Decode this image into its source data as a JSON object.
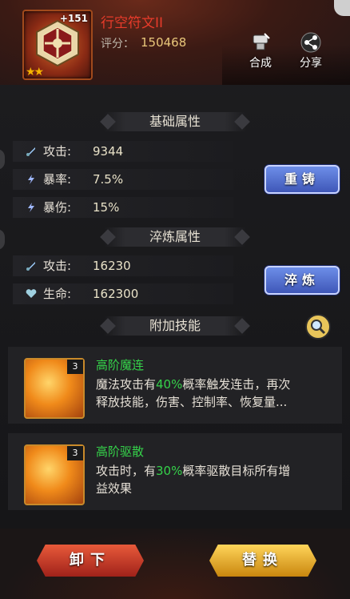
{
  "item": {
    "name": "行空符文II",
    "level_badge": "+151",
    "stars": "★★",
    "score_label": "评分：",
    "score_value": "150468"
  },
  "header_buttons": {
    "compose_label": "合成",
    "share_label": "分享"
  },
  "base_attrs": {
    "title": "基础属性",
    "rows": [
      {
        "label": "攻击:",
        "value": "9344",
        "icon": "sword-icon"
      },
      {
        "label": "暴率:",
        "value": "7.5%",
        "icon": "lightning-icon"
      },
      {
        "label": "暴伤:",
        "value": "15%",
        "icon": "lightning-icon"
      }
    ],
    "recast_button": "重铸"
  },
  "refine_attrs": {
    "title": "淬炼属性",
    "rows": [
      {
        "label": "攻击:",
        "value": "16230",
        "icon": "sword-icon"
      },
      {
        "label": "生命:",
        "value": "162300",
        "icon": "heart-icon"
      }
    ],
    "refine_button": "淬炼"
  },
  "skills": {
    "title": "附加技能",
    "items": [
      {
        "level": "3",
        "name": "高阶魔连",
        "desc_line1_pre": "魔法攻击有",
        "desc_line1_hl": "40%",
        "desc_line1_post": "概率触发连击，再次",
        "desc_line2": "释放技能，伤害、控制率、恢复量..."
      },
      {
        "level": "3",
        "name": "高阶驱散",
        "desc_line1_pre": "攻击时，有",
        "desc_line1_hl": "30%",
        "desc_line1_post": "概率驱散目标所有增",
        "desc_line2": "益效果"
      }
    ]
  },
  "actions": {
    "unequip": "卸下",
    "replace": "替换"
  },
  "colors": {
    "highlight_green": "#35d24a",
    "name_red": "#e83b2a",
    "score_gold": "#e9c77a"
  }
}
